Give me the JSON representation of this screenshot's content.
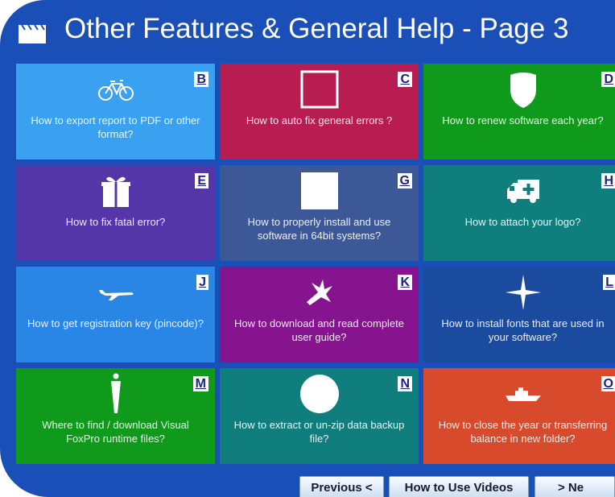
{
  "title": "Other Features & General Help - Page 3",
  "colors": {
    "frame": "#1a4fb8",
    "sky": "#3aa0f0",
    "crimson": "#b81d52",
    "green": "#0f9a1c",
    "purple": "#5536a8",
    "slate": "#3d5896",
    "teal": "#117e7e",
    "blue": "#2a86e4",
    "magenta": "#86148f",
    "navy": "#1b4b9e",
    "orange": "#d74a2c"
  },
  "tiles": [
    {
      "letter": "B",
      "label": "How to export report to PDF or other format?",
      "icon": "bicycle-icon",
      "color": "#3aa0f0"
    },
    {
      "letter": "C",
      "label": "How to auto fix general errors ?",
      "icon": "square-outline-icon",
      "color": "#b81d52"
    },
    {
      "letter": "D",
      "label": "How to renew software each year?",
      "icon": "shield-icon",
      "color": "#0f9a1c"
    },
    {
      "letter": "E",
      "label": "How to fix fatal error?",
      "icon": "gift-icon",
      "color": "#5536a8"
    },
    {
      "letter": "G",
      "label": "How to properly install and use software in 64bit systems?",
      "icon": "white-square-icon",
      "color": "#3d5896"
    },
    {
      "letter": "H",
      "label": "How to attach your logo?",
      "icon": "ambulance-icon",
      "color": "#117e7e"
    },
    {
      "letter": "J",
      "label": "How to get registration key (pincode)?",
      "icon": "airplane-icon",
      "color": "#2a86e4"
    },
    {
      "letter": "K",
      "label": "How to download and read complete user guide?",
      "icon": "bird-icon",
      "color": "#86148f"
    },
    {
      "letter": "L",
      "label": "How to install fonts that are used in your software?",
      "icon": "compass-star-icon",
      "color": "#1b4b9e"
    },
    {
      "letter": "M",
      "label": "Where to find / download Visual FoxPro runtime files?",
      "icon": "person-icon",
      "color": "#0f9a1c"
    },
    {
      "letter": "N",
      "label": "How to extract or un-zip data backup file?",
      "icon": "circle-icon",
      "color": "#117e7e"
    },
    {
      "letter": "O",
      "label": "How to close the year or transferring balance in new folder?",
      "icon": "ship-icon",
      "color": "#d74a2c"
    }
  ],
  "buttons": {
    "previous": "Previous <",
    "videos": "How to Use Videos",
    "next": "> Ne"
  }
}
